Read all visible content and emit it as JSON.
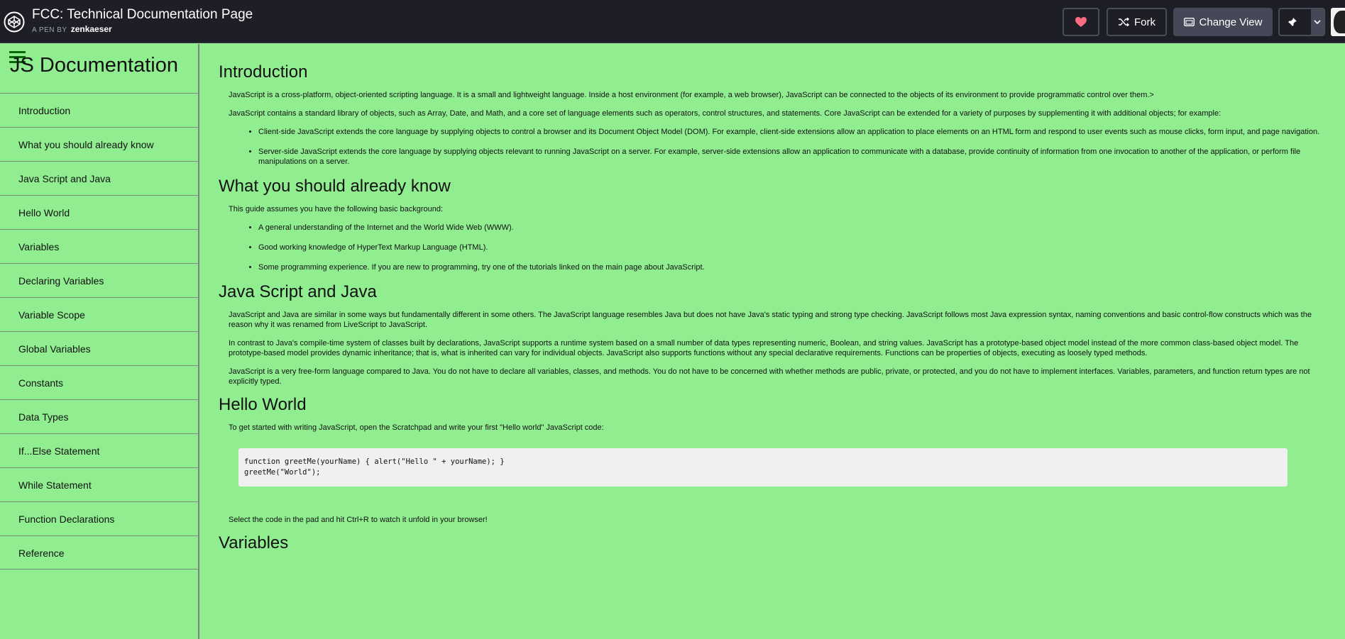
{
  "header": {
    "title": "FCC: Technical Documentation Page",
    "byline_prefix": "A PEN BY",
    "author": "zenkaeser",
    "fork_label": "Fork",
    "change_view_label": "Change View",
    "icons": {
      "logo": "codepen-logo-icon",
      "heart": "heart-icon",
      "fork": "fork-icon",
      "view": "change-view-icon",
      "pin": "pin-icon",
      "dropdown": "chevron-down-icon"
    },
    "heart_color": "#ff6b81"
  },
  "nav": {
    "title": "JS Documentation",
    "items": [
      "Introduction",
      "What you should already know",
      "Java Script and Java",
      "Hello World",
      "Variables",
      "Declaring Variables",
      "Variable Scope",
      "Global Variables",
      "Constants",
      "Data Types",
      "If...Else Statement",
      "While Statement",
      "Function Declarations",
      "Reference"
    ]
  },
  "sections": {
    "introduction": {
      "title": "Introduction",
      "p1": "JavaScript is a cross-platform, object-oriented scripting language. It is a small and lightweight language. Inside a host environment (for example, a web browser), JavaScript can be connected to the objects of its environment to provide programmatic control over them.>",
      "p2": "JavaScript contains a standard library of objects, such as Array, Date, and Math, and a core set of language elements such as operators, control structures, and statements. Core JavaScript can be extended for a variety of purposes by supplementing it with additional objects; for example:",
      "bullets": [
        "Client-side JavaScript extends the core language by supplying objects to control a browser and its Document Object Model (DOM). For example, client-side extensions allow an application to place elements on an HTML form and respond to user events such as mouse clicks, form input, and page navigation.",
        "Server-side JavaScript extends the core language by supplying objects relevant to running JavaScript on a server. For example, server-side extensions allow an application to communicate with a database, provide continuity of information from one invocation to another of the application, or perform file manipulations on a server."
      ]
    },
    "know": {
      "title": "What you should already know",
      "p1": "This guide assumes you have the following basic background:",
      "bullets": [
        "A general understanding of the Internet and the World Wide Web (WWW).",
        "Good working knowledge of HyperText Markup Language (HTML).",
        "Some programming experience. If you are new to programming, try one of the tutorials linked on the main page about JavaScript."
      ]
    },
    "java": {
      "title": "Java Script and Java",
      "p1": "JavaScript and Java are similar in some ways but fundamentally different in some others. The JavaScript language resembles Java but does not have Java's static typing and strong type checking. JavaScript follows most Java expression syntax, naming conventions and basic control-flow constructs which was the reason why it was renamed from LiveScript to JavaScript.",
      "p2": "In contrast to Java's compile-time system of classes built by declarations, JavaScript supports a runtime system based on a small number of data types representing numeric, Boolean, and string values. JavaScript has a prototype-based object model instead of the more common class-based object model. The prototype-based model provides dynamic inheritance; that is, what is inherited can vary for individual objects. JavaScript also supports functions without any special declarative requirements. Functions can be properties of objects, executing as loosely typed methods.",
      "p3": "JavaScript is a very free-form language compared to Java. You do not have to declare all variables, classes, and methods. You do not have to be concerned with whether methods are public, private, or protected, and you do not have to implement interfaces. Variables, parameters, and function return types are not explicitly typed."
    },
    "hello": {
      "title": "Hello World",
      "p1": "To get started with writing JavaScript, open the Scratchpad and write your first \"Hello world\" JavaScript code:",
      "code": [
        "function greetMe(yourName) { alert(\"Hello \" + yourName); }",
        "greetMe(\"World\");"
      ],
      "p2": "Select the code in the pad and hit Ctrl+R to watch it unfold in your browser!"
    },
    "variables": {
      "title": "Variables"
    }
  }
}
